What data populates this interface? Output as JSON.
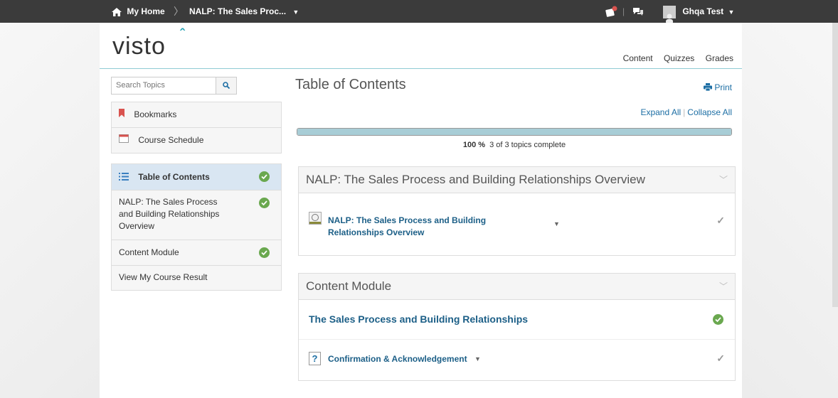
{
  "topbar": {
    "home_label": "My Home",
    "course_label": "NALP: The Sales Proc...",
    "user_name": "Ghqa Test"
  },
  "brand": {
    "logo_text": "visto",
    "accent": "#27a3b5"
  },
  "topnav": {
    "content": "Content",
    "quizzes": "Quizzes",
    "grades": "Grades"
  },
  "sidebar": {
    "search_placeholder": "Search Topics",
    "links": [
      {
        "label": "Bookmarks",
        "icon": "bookmark-icon"
      },
      {
        "label": "Course Schedule",
        "icon": "calendar-icon"
      }
    ],
    "toc": {
      "label": "Table of Contents",
      "items": [
        {
          "label": "NALP: The Sales Process and Building Relationships Overview",
          "complete": true
        },
        {
          "label": "Content Module",
          "complete": true
        },
        {
          "label": "View My Course Result",
          "complete": false
        }
      ]
    }
  },
  "main": {
    "title": "Table of Contents",
    "print_label": "Print",
    "expand_all": "Expand All",
    "collapse_all": "Collapse All",
    "progress": {
      "percent": 100,
      "percent_label": "100 %",
      "summary": "3 of 3 topics complete"
    },
    "modules": [
      {
        "title": "NALP: The Sales Process and Building Relationships Overview",
        "topics": [
          {
            "label": "NALP: The Sales Process and Building Relationships Overview",
            "icon": "web-page-icon",
            "status": "viewed"
          }
        ]
      },
      {
        "title": "Content Module",
        "subheading": "The Sales Process and Building Relationships",
        "topics": [
          {
            "label": "Confirmation & Acknowledgement",
            "icon": "help-icon",
            "status": "viewed"
          }
        ]
      }
    ]
  }
}
